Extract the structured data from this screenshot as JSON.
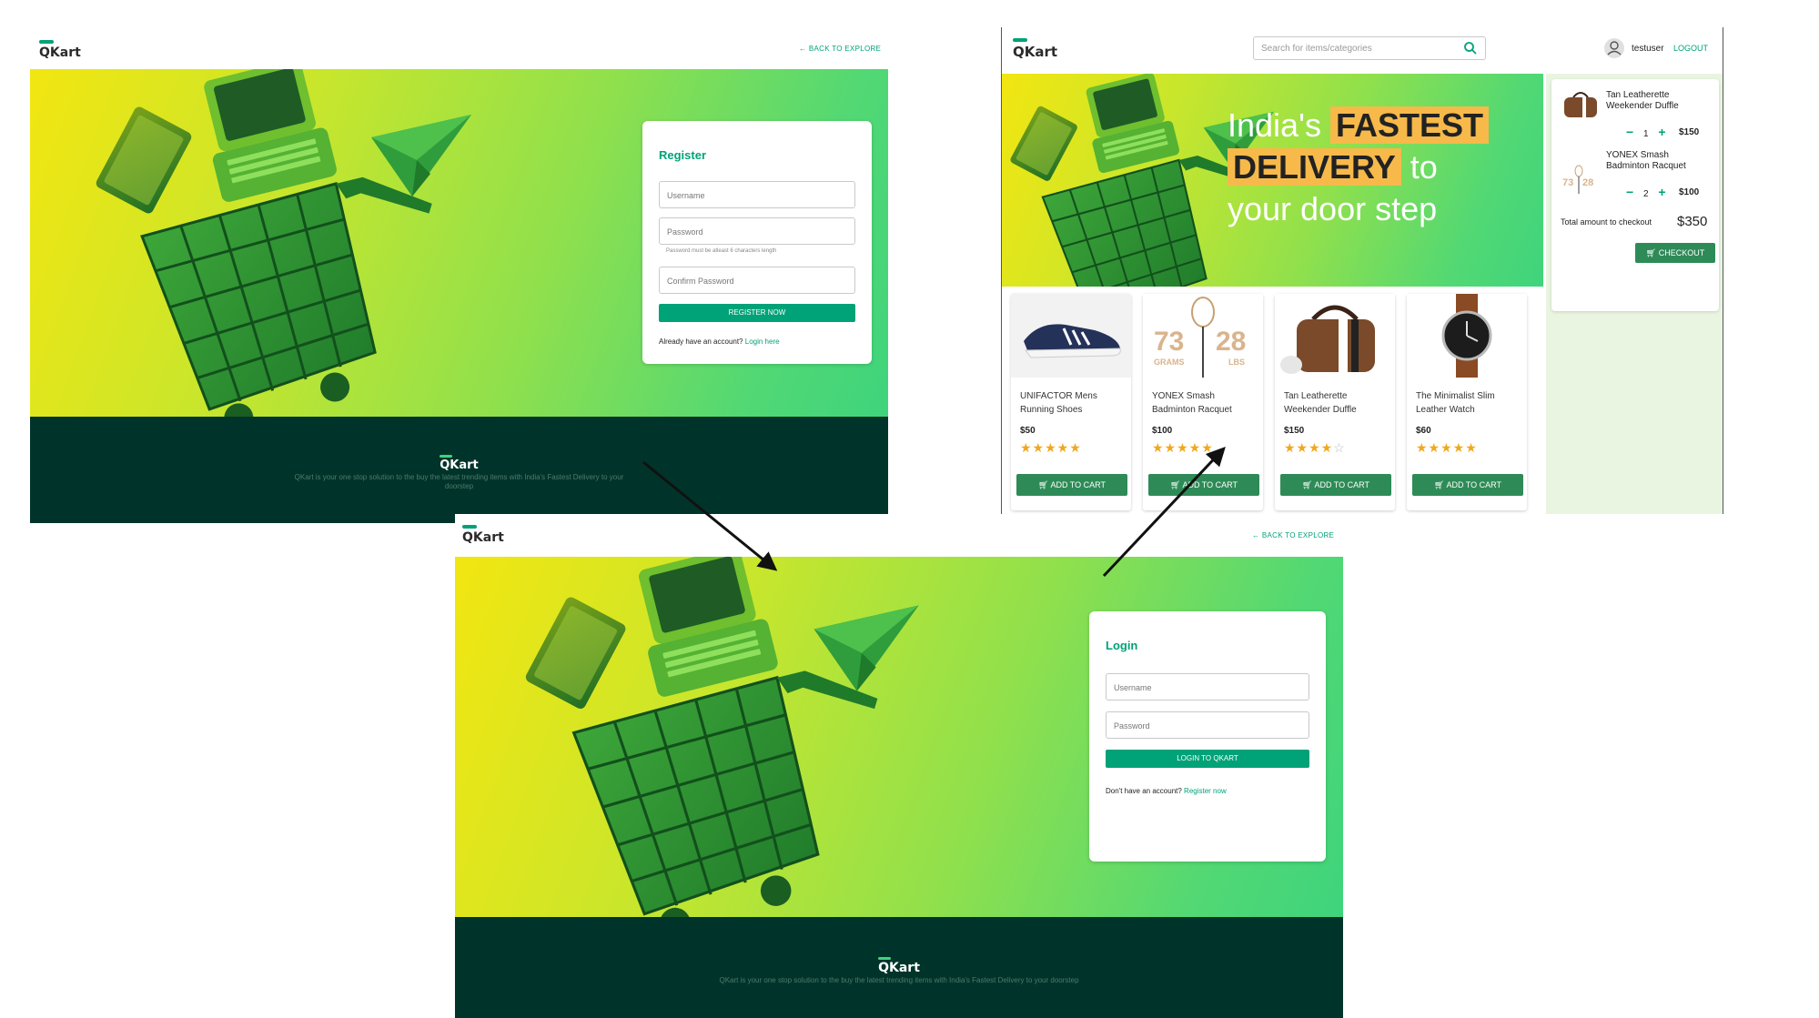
{
  "brand": {
    "name": "QKart",
    "accent": "#00a278",
    "footer_bg": "#00342a"
  },
  "register_page": {
    "back_link": "BACK TO EXPLORE",
    "title": "Register",
    "username_placeholder": "Username",
    "password_placeholder": "Password",
    "password_hint": "Password must be atleast 6 characters length",
    "confirm_placeholder": "Confirm Password",
    "submit_label": "REGISTER NOW",
    "alt_text": "Already have an account?",
    "alt_link": "Login here",
    "footer_logo": "QKart",
    "footer_text": "QKart is your one stop solution to the buy the latest trending items with India's Fastest Delivery to your doorstep"
  },
  "products_page": {
    "search_placeholder": "Search for items/categories",
    "username": "testuser",
    "logout_label": "LOGOUT",
    "hero_line1": "India's",
    "hero_hl1": "FASTEST",
    "hero_hl2": "DELIVERY",
    "hero_line2_rest": "to",
    "hero_line3": "your door step",
    "products": [
      {
        "name": "UNIFACTOR Mens Running Shoes",
        "price": "$50",
        "rating": 5,
        "stars_on": "★★★★★",
        "stars_off": "",
        "button": "ADD TO CART"
      },
      {
        "name": "YONEX Smash Badminton Racquet",
        "price": "$100",
        "rating": 5,
        "stars_on": "★★★★★",
        "stars_off": "",
        "button": "ADD TO CART",
        "img_left": "73",
        "img_right": "28",
        "img_left_unit": "GRAMS",
        "img_right_unit": "LBS"
      },
      {
        "name": "Tan Leatherette Weekender Duffle",
        "price": "$150",
        "rating": 4,
        "stars_on": "★★★★",
        "stars_off": "☆",
        "button": "ADD TO CART"
      },
      {
        "name": "The Minimalist Slim Leather Watch",
        "price": "$60",
        "rating": 5,
        "stars_on": "★★★★★",
        "stars_off": "",
        "button": "ADD TO CART"
      }
    ],
    "cart": {
      "items": [
        {
          "name": "Tan Leatherette Weekender Duffle",
          "qty": "1",
          "price": "$150"
        },
        {
          "name": "YONEX Smash Badminton Racquet",
          "qty": "2",
          "price": "$100"
        }
      ],
      "thumb_labels": [
        "73",
        "28"
      ],
      "minus": "−",
      "plus": "+",
      "total_label": "Total amount to checkout",
      "total_value": "$350",
      "checkout_label": "CHECKOUT"
    }
  },
  "login_page": {
    "back_link": "BACK TO EXPLORE",
    "title": "Login",
    "username_placeholder": "Username",
    "password_placeholder": "Password",
    "submit_label": "LOGIN TO QKART",
    "alt_text": "Don't have an account?",
    "alt_link": "Register now",
    "footer_logo": "QKart",
    "footer_text": "QKart is your one stop solution to the buy the latest trending items with India's Fastest Delivery to your doorstep"
  }
}
